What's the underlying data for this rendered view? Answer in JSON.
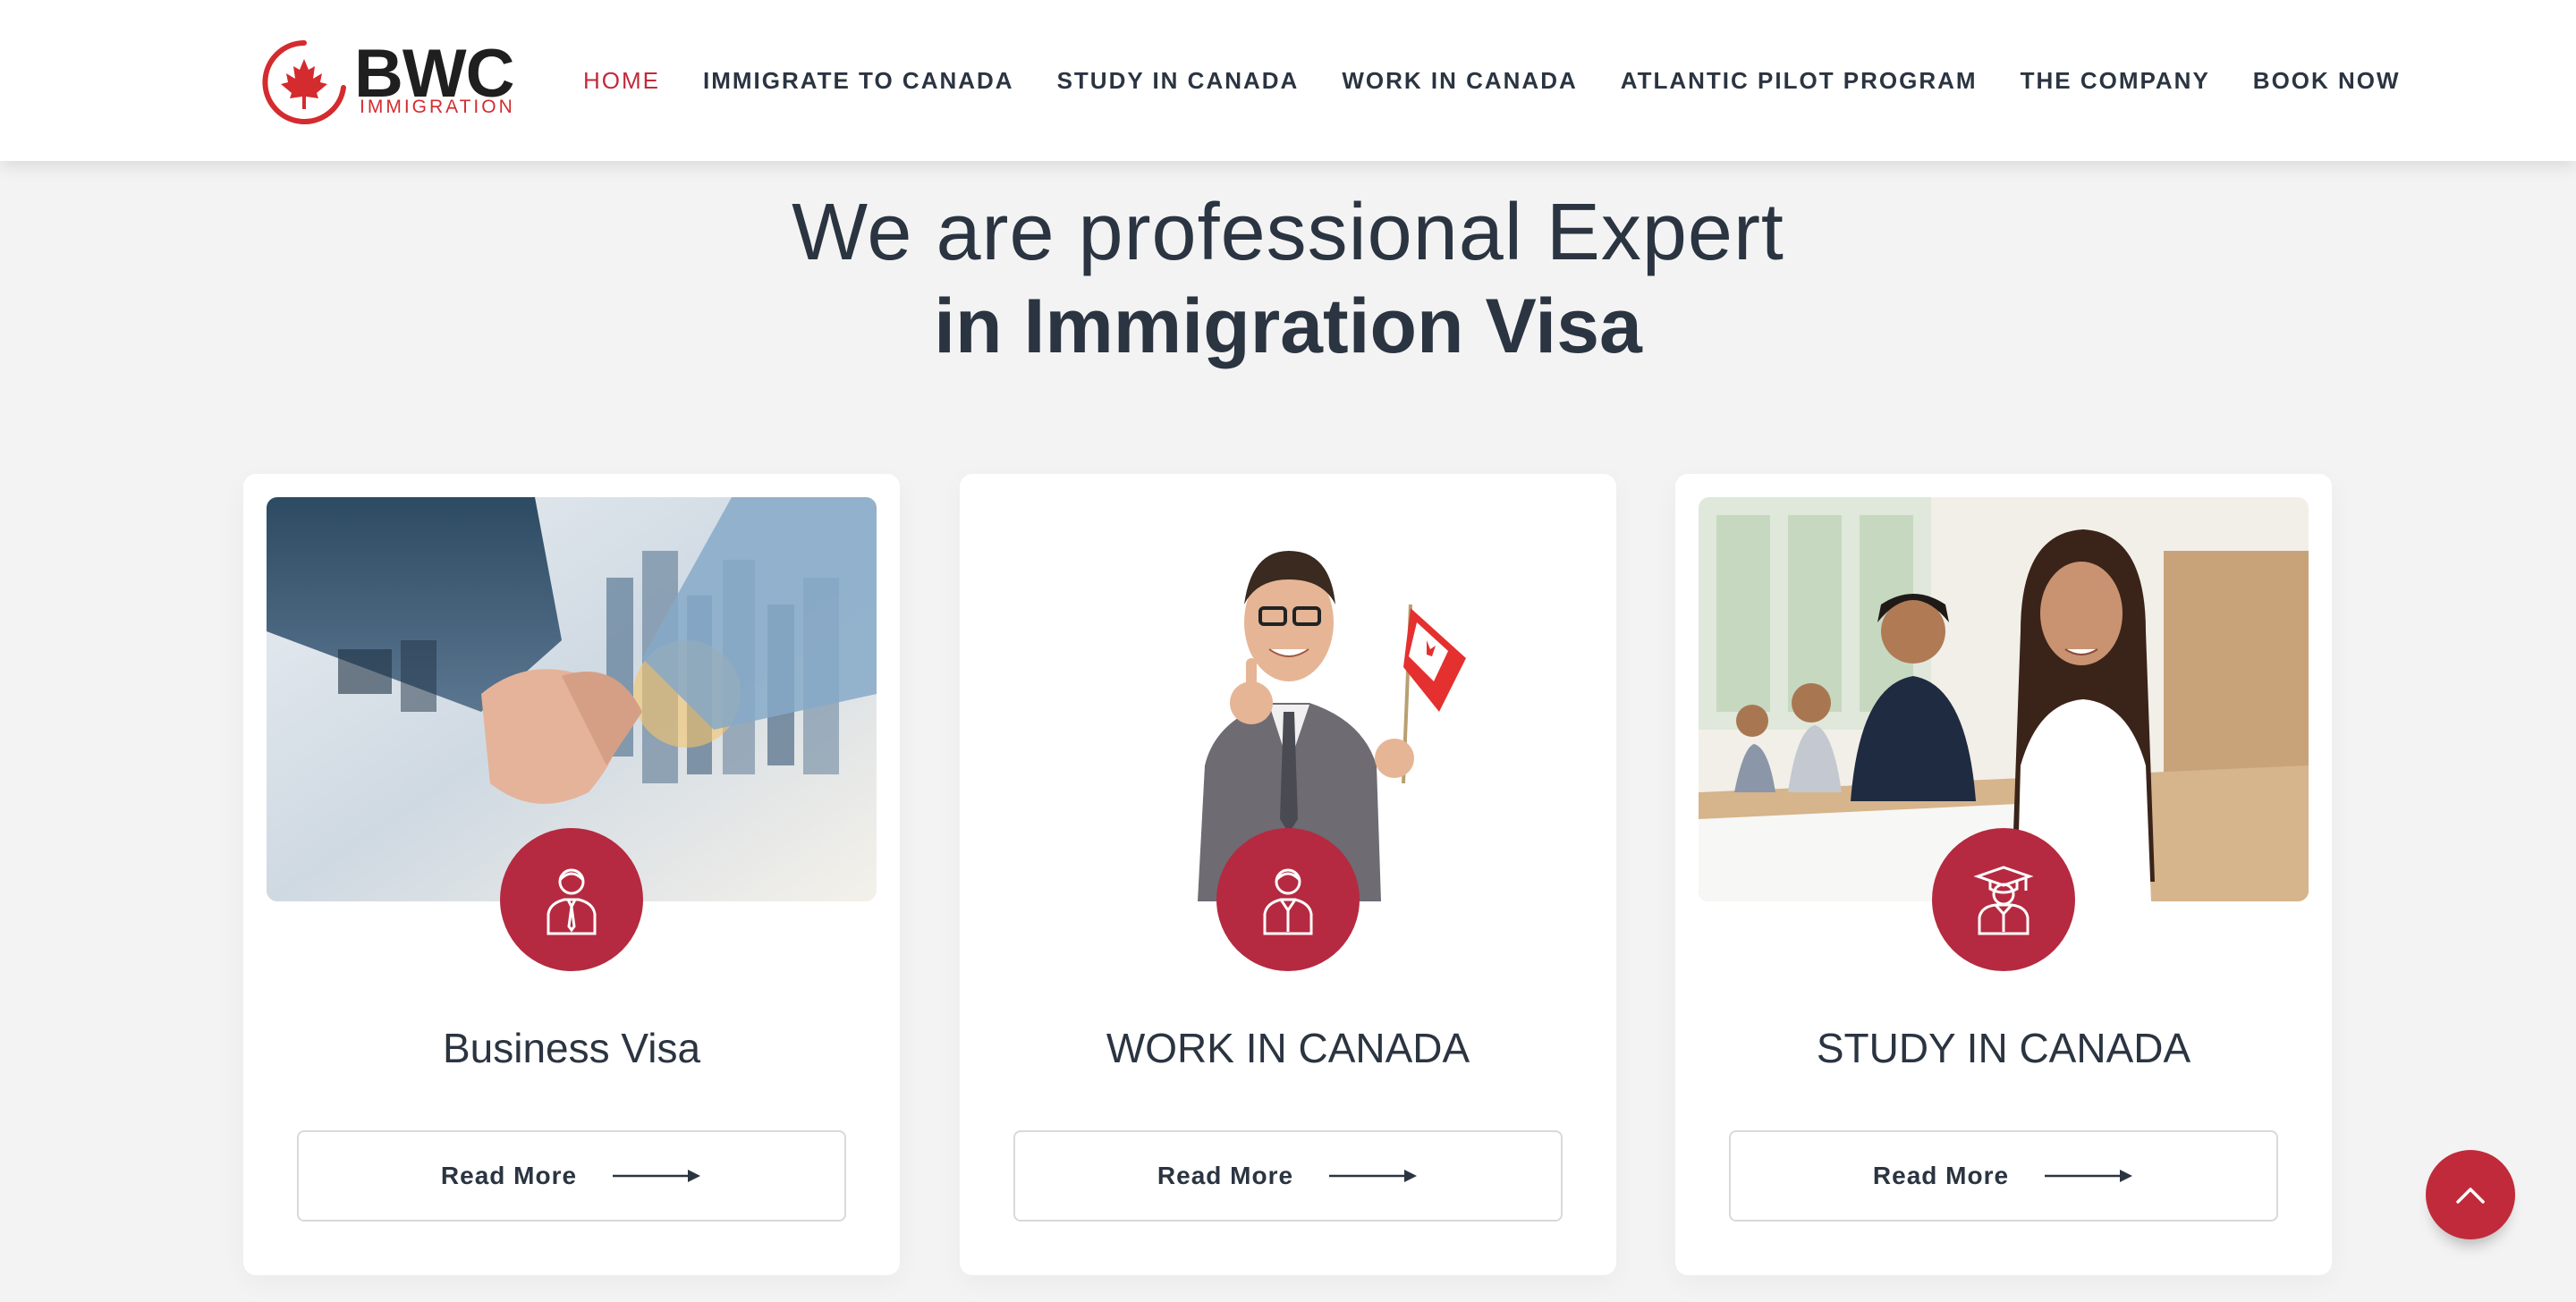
{
  "brand": {
    "name": "BWC",
    "subtitle": "IMMIGRATION",
    "accent_color": "#d42b2f"
  },
  "nav": {
    "items": [
      {
        "label": "HOME",
        "active": true
      },
      {
        "label": "IMMIGRATE TO CANADA",
        "active": false
      },
      {
        "label": "STUDY IN CANADA",
        "active": false
      },
      {
        "label": "WORK IN CANADA",
        "active": false
      },
      {
        "label": "ATLANTIC PILOT PROGRAM",
        "active": false
      },
      {
        "label": "THE COMPANY",
        "active": false
      },
      {
        "label": "BOOK NOW",
        "active": false
      }
    ]
  },
  "hero": {
    "line1": "We are professional Expert",
    "line2": "in Immigration Visa"
  },
  "cards": [
    {
      "title": "Business Visa",
      "button": "Read More",
      "image": "handshake-city-photo",
      "icon": "businessman-icon"
    },
    {
      "title": "WORK IN CANADA",
      "button": "Read More",
      "image": "man-with-canada-flag-photo",
      "icon": "worker-icon"
    },
    {
      "title": "STUDY IN CANADA",
      "button": "Read More",
      "image": "students-classroom-photo",
      "icon": "graduate-icon"
    }
  ],
  "colors": {
    "badge": "#b52a40",
    "active_nav": "#c4293a",
    "text": "#2b3441"
  },
  "scroll_top": {
    "icon": "chevron-up-icon"
  }
}
